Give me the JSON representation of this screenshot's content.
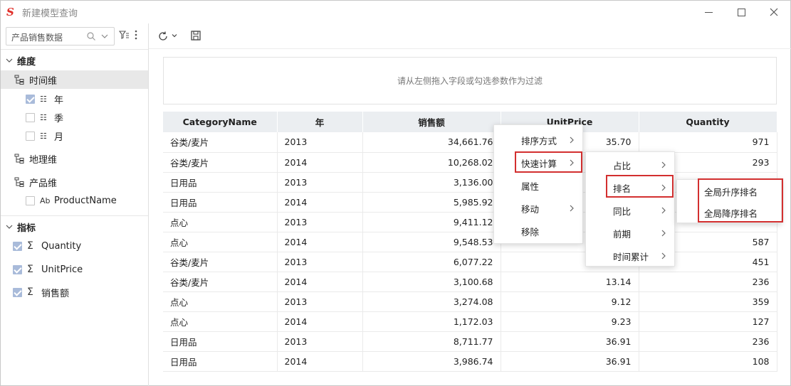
{
  "window": {
    "title": "新建模型查询",
    "logo": "S"
  },
  "left_panel": {
    "dataset_name": "产品销售数据",
    "sections": {
      "dimensions": {
        "label": "维度",
        "groups": [
          {
            "label": "时间维",
            "fields": [
              {
                "label": "年",
                "checked": true
              },
              {
                "label": "季",
                "checked": false
              },
              {
                "label": "月",
                "checked": false
              }
            ]
          },
          {
            "label": "地理维",
            "fields": []
          },
          {
            "label": "产品维",
            "fields": [
              {
                "label": "ProductName",
                "checked": false,
                "type_icon": "Ab"
              }
            ]
          }
        ]
      },
      "measures": {
        "label": "指标",
        "fields": [
          {
            "label": "Quantity",
            "checked": true,
            "type_icon": "Σ"
          },
          {
            "label": "UnitPrice",
            "checked": true,
            "type_icon": "Σ"
          },
          {
            "label": "销售额",
            "checked": true,
            "type_icon": "Σ"
          }
        ]
      }
    }
  },
  "filter_zone": {
    "placeholder": "请从左侧拖入字段或勾选参数作为过滤"
  },
  "table": {
    "columns": [
      "CategoryName",
      "年",
      "销售额",
      "UnitPrice",
      "Quantity"
    ],
    "rows": [
      [
        "谷类/麦片",
        "2013",
        "34,661.76",
        "35.70",
        "971"
      ],
      [
        "谷类/麦片",
        "2014",
        "10,268.02",
        "",
        "293"
      ],
      [
        "日用品",
        "2013",
        "3,136.00",
        "",
        ""
      ],
      [
        "日用品",
        "2014",
        "5,985.92",
        "",
        ""
      ],
      [
        "点心",
        "2013",
        "9,411.12",
        "",
        ""
      ],
      [
        "点心",
        "2014",
        "9,548.53",
        "",
        "587"
      ],
      [
        "谷类/麦片",
        "2013",
        "6,077.22",
        "",
        "451"
      ],
      [
        "谷类/麦片",
        "2014",
        "3,100.68",
        "13.14",
        "236"
      ],
      [
        "点心",
        "2013",
        "3,274.08",
        "9.12",
        "359"
      ],
      [
        "点心",
        "2014",
        "1,172.03",
        "9.23",
        "127"
      ],
      [
        "日用品",
        "2013",
        "8,711.77",
        "36.91",
        "236"
      ],
      [
        "日用品",
        "2014",
        "3,986.74",
        "36.91",
        "108"
      ]
    ]
  },
  "context_menu": {
    "items": [
      "排序方式",
      "快速计算",
      "属性",
      "移动",
      "移除"
    ]
  },
  "submenu_quick_calc": {
    "items": [
      "占比",
      "排名",
      "同比",
      "前期",
      "时间累计"
    ]
  },
  "submenu_rank": {
    "items": [
      "全局升序排名",
      "全局降序排名"
    ]
  },
  "colors": {
    "highlight": "#d32f2f",
    "header_bg": "#ebeef1",
    "selected_row": "#e8e8e8",
    "checkbox_checked": "#a9bbda"
  }
}
